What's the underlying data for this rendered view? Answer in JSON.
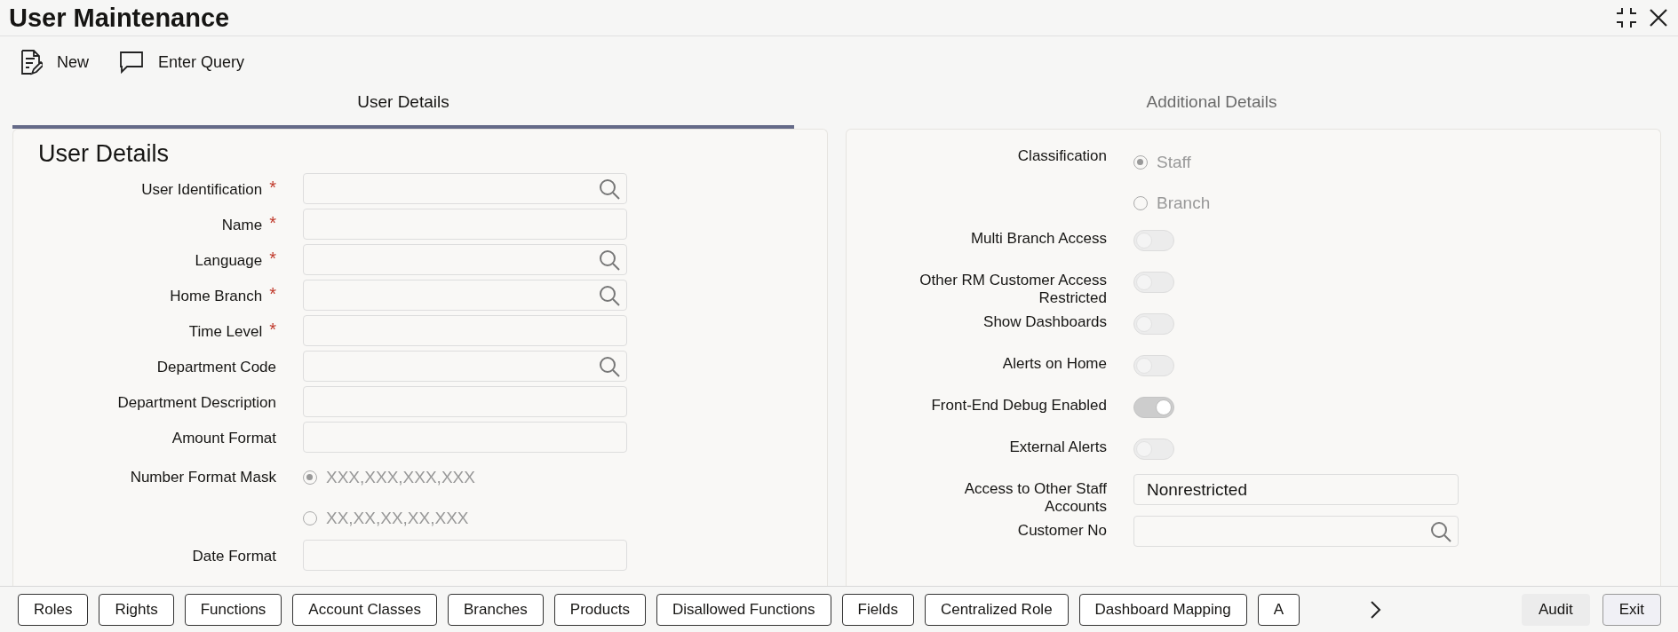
{
  "window": {
    "title": "User Maintenance"
  },
  "toolbar": [
    {
      "kind": "new",
      "label": "New"
    },
    {
      "kind": "query",
      "label": "Enter Query"
    }
  ],
  "tabs": [
    {
      "label": "User Details",
      "selected": true
    },
    {
      "label": "Additional Details",
      "selected": false
    }
  ],
  "user_details": {
    "heading": "User Details",
    "fields": [
      {
        "label": "User Identification",
        "required_mark": "*",
        "kind": "lookup"
      },
      {
        "label": "Name",
        "required_mark": "*",
        "kind": "text"
      },
      {
        "label": "Language",
        "required_mark": "*",
        "kind": "lookup"
      },
      {
        "label": "Home Branch",
        "required_mark": "*",
        "kind": "lookup"
      },
      {
        "label": "Time Level",
        "required_mark": "*",
        "kind": "text"
      },
      {
        "label": "Department Code",
        "kind": "lookup"
      },
      {
        "label": "Department Description",
        "kind": "text"
      },
      {
        "label": "Amount Format",
        "kind": "text"
      },
      {
        "label": "Number Format Mask",
        "kind": "radio",
        "options": [
          {
            "label": "XXX,XXX,XXX,XXX",
            "selected": true
          },
          {
            "label": "XX,XX,XX,XX,XXX",
            "selected": false
          }
        ]
      },
      {
        "label": "Date Format",
        "kind": "text"
      }
    ]
  },
  "additional_details": {
    "fields": [
      {
        "label": "Classification",
        "kind": "radio",
        "options": [
          {
            "label": "Staff",
            "selected": true
          },
          {
            "label": "Branch",
            "selected": false
          }
        ]
      },
      {
        "label": "Multi Branch Access",
        "kind": "toggle",
        "on": false
      },
      {
        "label": "Other RM Customer Access Restricted",
        "kind": "toggle",
        "on": false
      },
      {
        "label": "Show Dashboards",
        "kind": "toggle",
        "on": false
      },
      {
        "label": "Alerts on Home",
        "kind": "toggle",
        "on": false
      },
      {
        "label": "Front-End Debug Enabled",
        "kind": "toggle",
        "on": true
      },
      {
        "label": "External Alerts",
        "kind": "toggle",
        "on": false
      },
      {
        "label": "Access to Other Staff Accounts",
        "kind": "text",
        "value": "Nonrestricted"
      },
      {
        "label": "Customer No",
        "kind": "lookup"
      }
    ]
  },
  "footer": {
    "buttons": [
      "Roles",
      "Rights",
      "Functions",
      "Account Classes",
      "Branches",
      "Products",
      "Disallowed Functions",
      "Fields",
      "Centralized Role",
      "Dashboard Mapping",
      "A"
    ],
    "actions": [
      {
        "label": "Audit",
        "disabled": true
      },
      {
        "label": "Exit",
        "disabled": false
      }
    ]
  }
}
